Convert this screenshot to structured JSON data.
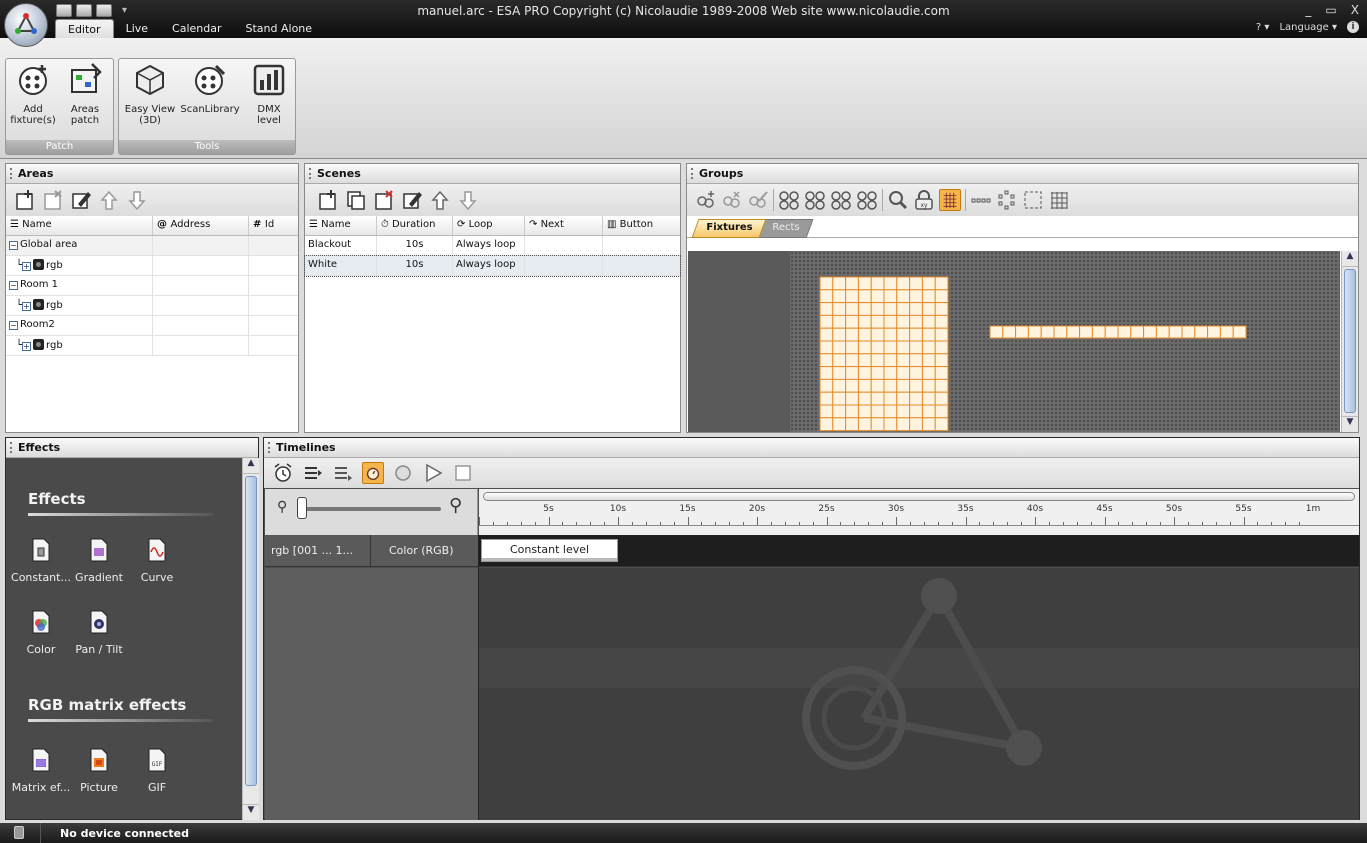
{
  "window": {
    "title": "manuel.arc - ESA PRO   Copyright (c) Nicolaudie 1989-2008   Web site www.nicolaudie.com",
    "controls": [
      "_",
      "▭",
      "X"
    ]
  },
  "tabs": [
    "Editor",
    "Live",
    "Calendar",
    "Stand Alone"
  ],
  "help": {
    "question": "? ▾",
    "language": "Language ▾"
  },
  "ribbon": {
    "patch": {
      "label": "Patch",
      "add_fixtures": "Add fixture(s)",
      "areas_patch": "Areas patch"
    },
    "tools": {
      "label": "Tools",
      "easy_view": "Easy View (3D)",
      "scanlibrary": "ScanLibrary",
      "dmx_level": "DMX level"
    }
  },
  "areas": {
    "title": "Areas",
    "columns": {
      "name": "Name",
      "address": "Address",
      "id": "Id"
    },
    "rows": [
      {
        "name": "Global area",
        "level": 0
      },
      {
        "name": "rgb",
        "level": 1
      },
      {
        "name": "Room 1",
        "level": 0
      },
      {
        "name": "rgb",
        "level": 1
      },
      {
        "name": "Room2",
        "level": 0
      },
      {
        "name": "rgb",
        "level": 1
      }
    ]
  },
  "scenes": {
    "title": "Scenes",
    "columns": {
      "name": "Name",
      "duration": "Duration",
      "loop": "Loop",
      "next": "Next",
      "button": "Button"
    },
    "rows": [
      {
        "name": "Blackout",
        "duration": "10s",
        "loop": "Always loop"
      },
      {
        "name": "White",
        "duration": "10s",
        "loop": "Always loop"
      }
    ]
  },
  "groups": {
    "title": "Groups",
    "subtabs": [
      "Fixtures",
      "Rects"
    ],
    "matrix": {
      "cols": 10,
      "rows": 12
    },
    "strip": {
      "cells": 20
    }
  },
  "effects": {
    "title": "Effects",
    "section1": "Effects",
    "section2": "RGB matrix effects",
    "items1": [
      "Constant...",
      "Gradient",
      "Curve",
      "Color",
      "Pan / Tilt"
    ],
    "items2": [
      "Matrix ef...",
      "Picture",
      "GIF"
    ]
  },
  "timelines": {
    "title": "Timelines",
    "ruler": [
      "5s",
      "10s",
      "15s",
      "20s",
      "25s",
      "30s",
      "35s",
      "40s",
      "45s",
      "50s",
      "55s",
      "1m"
    ],
    "track": {
      "fixture": "rgb [001 ... 1...",
      "channel": "Color (RGB)",
      "clip": "Constant level"
    }
  },
  "status": {
    "text": "No device connected"
  },
  "colors": {
    "accent": "#f5a623",
    "matrix_cell": "#fff4e0",
    "matrix_border": "#e58a2a"
  }
}
